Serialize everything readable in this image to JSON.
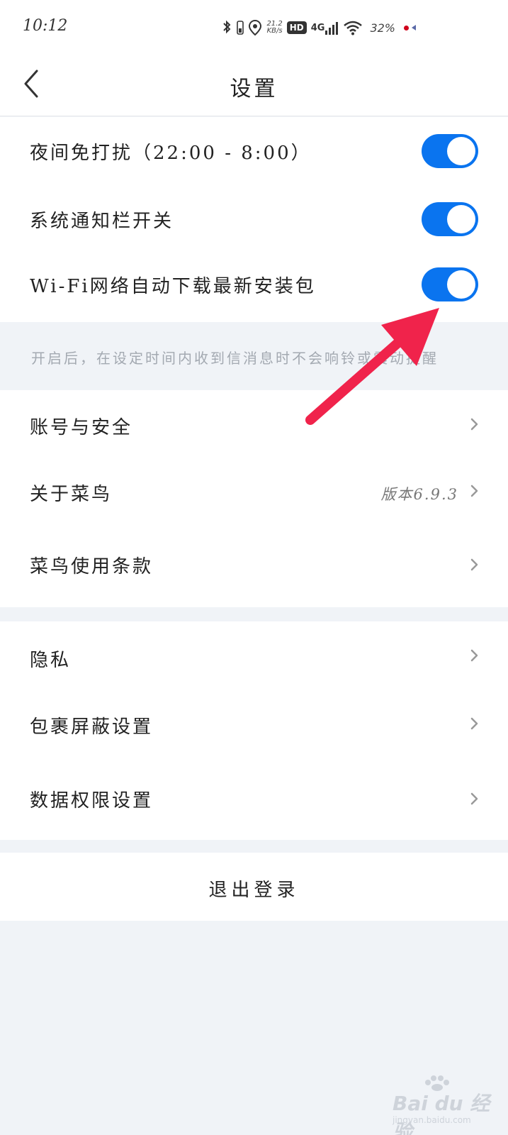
{
  "status_bar": {
    "time": "10:12",
    "net_speed_value": "21.2",
    "net_speed_unit": "KB/s",
    "hd_label": "HD",
    "signal_label": "4G",
    "battery": "32%"
  },
  "nav": {
    "title": "设置"
  },
  "toggles": [
    {
      "label": "夜间免打扰（22:00 - 8:00）",
      "on": true
    },
    {
      "label": "系统通知栏开关",
      "on": true
    },
    {
      "label": "Wi-Fi网络自动下载最新安装包",
      "on": true
    }
  ],
  "hint": "开启后，在设定时间内收到信消息时不会响铃或震动提醒",
  "group1": [
    {
      "label": "账号与安全"
    },
    {
      "label": "关于菜鸟",
      "value": "版本6.9.3"
    },
    {
      "label": "菜鸟使用条款"
    }
  ],
  "group2": [
    {
      "label": "隐私"
    },
    {
      "label": "包裹屏蔽设置"
    },
    {
      "label": "数据权限设置"
    }
  ],
  "logout": "退出登录",
  "watermark": {
    "main": "Bai du 经验",
    "sub": "jingyan.baidu.com"
  },
  "colors": {
    "toggle_on": "#0a74ef",
    "annotation_arrow": "#f0234b",
    "background": "#f0f3f7"
  }
}
